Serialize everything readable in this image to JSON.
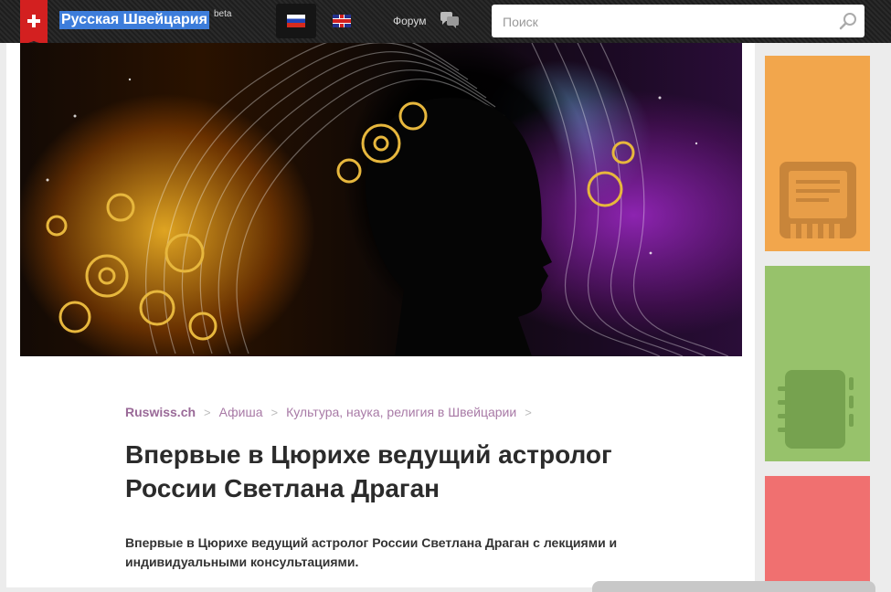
{
  "header": {
    "site_title": "Русская Швейцария",
    "beta_label": "beta",
    "forum_label": "Форум",
    "languages": [
      {
        "code": "ru",
        "active": true
      },
      {
        "code": "en",
        "active": false
      }
    ],
    "search_placeholder": "Поиск"
  },
  "breadcrumb": {
    "items": [
      "Ruswiss.ch",
      "Афиша",
      "Культура, наука, религия в Швейцарии"
    ]
  },
  "article": {
    "title": "Впервые в Цюрихе ведущий астролог России Светлана Драган",
    "lead": "Впервые в Цюрихе ведущий астролог России Светлана Драган с лекциями и индивидуальными консультациями."
  },
  "sidebar": {
    "tiles": [
      {
        "color": "#f2a64c",
        "icon": "document-icon"
      },
      {
        "color": "#97c26b",
        "icon": "notebook-icon"
      },
      {
        "color": "#f07070",
        "icon": ""
      }
    ]
  },
  "colors": {
    "accent": "#d32020",
    "breadcrumb": "#a87aa6",
    "title_text": "#2b2b2b"
  }
}
